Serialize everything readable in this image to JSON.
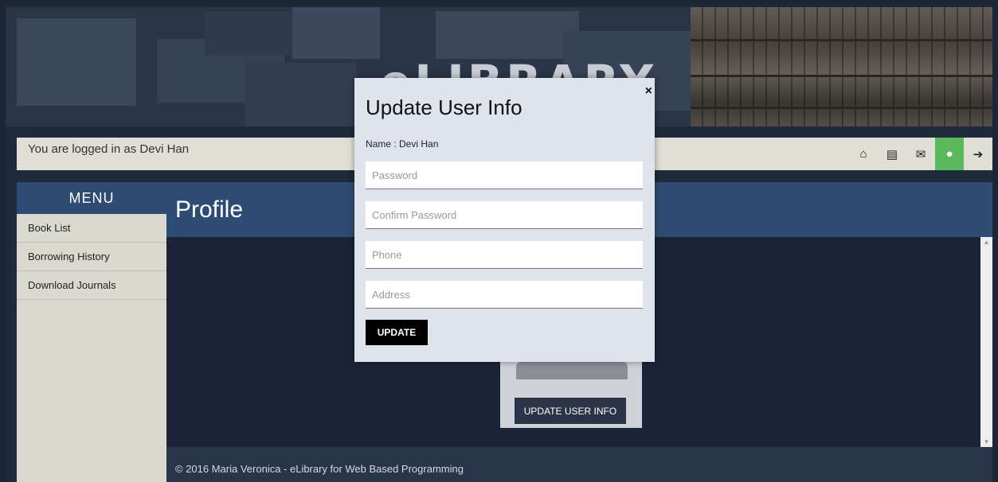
{
  "brand": {
    "title": "eLIBRARY"
  },
  "logbar": {
    "text": "You are logged in as Devi Han",
    "icons": [
      {
        "name": "home-icon",
        "glyph": "⌂"
      },
      {
        "name": "id-card-icon",
        "glyph": "▤"
      },
      {
        "name": "envelope-icon",
        "glyph": "✉"
      },
      {
        "name": "user-icon",
        "glyph": "●"
      },
      {
        "name": "sign-out-icon",
        "glyph": "➔"
      }
    ],
    "active_color": "#5cb85c"
  },
  "sidebar": {
    "title": "MENU",
    "items": [
      {
        "label": "Book List"
      },
      {
        "label": "Borrowing History"
      },
      {
        "label": "Download Journals"
      }
    ]
  },
  "main": {
    "title": "Profile",
    "update_info_button": "UPDATE USER INFO"
  },
  "footer": {
    "text": "© 2016 Maria Veronica - eLibrary for Web Based Programming"
  },
  "modal": {
    "close": "×",
    "title": "Update User Info",
    "name_line": "Name : Devi Han",
    "fields": {
      "password": "Password",
      "confirm": "Confirm Password",
      "phone": "Phone",
      "address": "Address"
    },
    "submit": "UPDATE"
  },
  "colors": {
    "header_blue": "#2e4b73",
    "modal_bg": "#dfe4ec"
  }
}
